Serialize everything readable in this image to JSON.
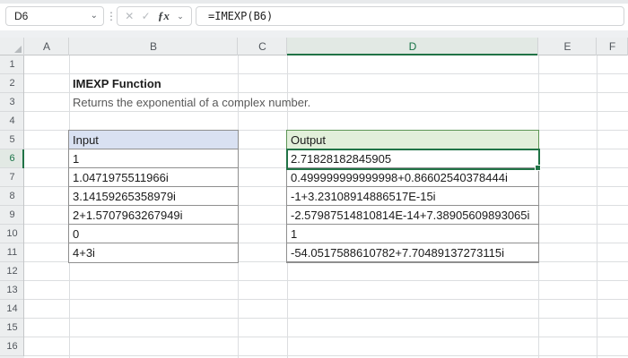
{
  "formula_bar": {
    "name_box_value": "D6",
    "formula_value": "=IMEXP(B6)"
  },
  "icons": {
    "name_box_chevron": "⌄",
    "more_options": "⋮",
    "cancel": "✕",
    "check": "✓",
    "function_fx": "ƒx",
    "fx_chevron": "⌄"
  },
  "grid": {
    "column_headers": [
      "A",
      "B",
      "C",
      "D",
      "E",
      "F"
    ],
    "row_numbers": [
      "1",
      "2",
      "3",
      "4",
      "5",
      "6",
      "7",
      "8",
      "9",
      "10",
      "11",
      "12",
      "13",
      "14",
      "15",
      "16"
    ],
    "active_cell": "D6",
    "active_column": "D",
    "active_row": "6"
  },
  "sheet_content": {
    "title": "IMEXP Function",
    "subtitle": "Returns the exponential of a complex number.",
    "input_table": {
      "header": "Input",
      "rows": [
        "1",
        "1.0471975511966i",
        "3.14159265358979i",
        "2+1.5707963267949i",
        "0",
        "4+3i"
      ]
    },
    "output_table": {
      "header": "Output",
      "rows": [
        "2.71828182845905",
        "0.499999999999998+0.86602540378444i",
        "-1+3.23108914886517E-15i",
        "-2.57987514810814E-14+7.38905609893065i",
        "1",
        "-54.0517588610782+7.70489137273115i"
      ]
    }
  },
  "colors": {
    "selection_green": "#217346",
    "input_header_fill": "#D9E1F2",
    "output_header_fill": "#E2EFDA",
    "output_header_border": "#5d9555",
    "table_border": "#8f8f8f",
    "gridline": "#dcdee0",
    "header_bg": "#eceeef",
    "active_header_bg": "#e2e9e4"
  }
}
